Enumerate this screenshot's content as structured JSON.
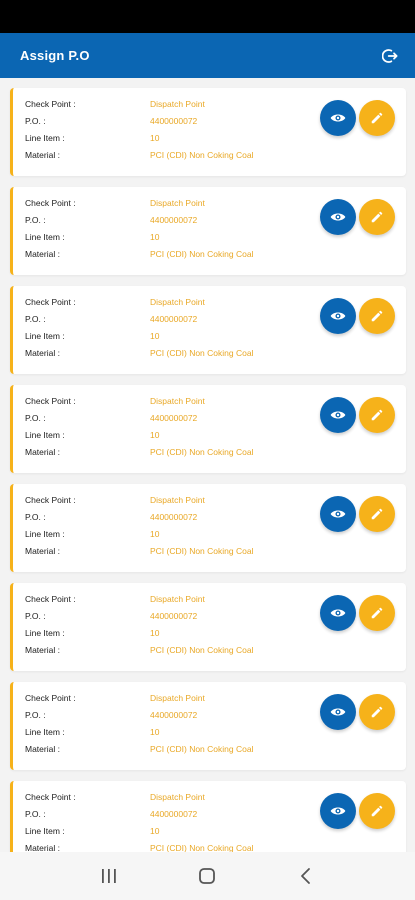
{
  "app": {
    "title": "Assign P.O",
    "accent": "#0b66b3",
    "highlight": "#f6b21a"
  },
  "icons": {
    "logout": "logout-icon",
    "view": "eye-icon",
    "edit": "pencil-icon"
  },
  "labels": {
    "check_point": "Check Point :",
    "po": "P.O. :",
    "line_item": "Line Item :",
    "material": "Material :"
  },
  "cards": [
    {
      "check_point": "Dispatch Point",
      "po": "4400000072",
      "line_item": "10",
      "material": "PCI (CDI) Non Coking Coal"
    },
    {
      "check_point": "Dispatch Point",
      "po": "4400000072",
      "line_item": "10",
      "material": "PCI (CDI) Non Coking Coal"
    },
    {
      "check_point": "Dispatch Point",
      "po": "4400000072",
      "line_item": "10",
      "material": "PCI (CDI) Non Coking Coal"
    },
    {
      "check_point": "Dispatch Point",
      "po": "4400000072",
      "line_item": "10",
      "material": "PCI (CDI) Non Coking Coal"
    },
    {
      "check_point": "Dispatch Point",
      "po": "4400000072",
      "line_item": "10",
      "material": "PCI (CDI) Non Coking Coal"
    },
    {
      "check_point": "Dispatch Point",
      "po": "4400000072",
      "line_item": "10",
      "material": "PCI (CDI) Non Coking Coal"
    },
    {
      "check_point": "Dispatch Point",
      "po": "4400000072",
      "line_item": "10",
      "material": "PCI (CDI) Non Coking Coal"
    },
    {
      "check_point": "Dispatch Point",
      "po": "4400000072",
      "line_item": "10",
      "material": "PCI (CDI) Non Coking Coal"
    }
  ],
  "nav": {
    "recents": "recents-icon",
    "home": "home-icon",
    "back": "back-icon"
  }
}
